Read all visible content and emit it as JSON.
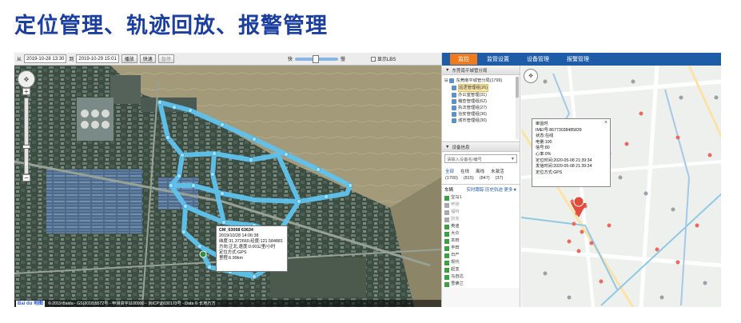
{
  "headline": "定位管理、轨迹回放、报警管理",
  "playback": {
    "toolbar": {
      "from_label": "从",
      "from_value": "2019-10-28 13:30",
      "to_label": "到",
      "to_value": "2019-10-29 15:01",
      "play_label": "播放",
      "fast_label": "快速",
      "pause_label": "暂停",
      "speed_fast": "快",
      "speed_slow": "慢",
      "show_lbs_label": "显示LBS"
    },
    "popup": {
      "title": "CM_63058 63634",
      "time": "2019/10/28 14:06:38",
      "coords": "纬度:31.372660,经度:121.584881",
      "direction": "方向:正北,速度:0.00公里/小时",
      "mode": "定位方式:GPS",
      "mileage": "里程:6.99km"
    },
    "footer": {
      "logo": "Bai du 地图",
      "copyright": "© 2019 Baidu - GS(2018)5572号 - 甲测资字1100930 - 京ICP证030173号 - Data © 长地万方"
    }
  },
  "monitor": {
    "nav_tabs": [
      "监控",
      "监管设置",
      "设备管理",
      "报警管理"
    ],
    "active_tab": "监控",
    "tree_header": "东莞南平城管分局",
    "tree": {
      "root": "东莞南平城管分局(1799)",
      "items": [
        {
          "label": "巡逻管理组(26)",
          "selected": true
        },
        {
          "label": "办公室管理(31)",
          "selected": false
        },
        {
          "label": "稽查管理组(62)",
          "selected": false
        },
        {
          "label": "执法管理组(27)",
          "selected": false
        },
        {
          "label": "治安管理组(36)",
          "selected": false
        },
        {
          "label": "城市管理组(30)",
          "selected": false
        }
      ]
    },
    "device_header": "设备信息",
    "search_placeholder": "请输入设备名/编号",
    "tabs": [
      "全部",
      "在线",
      "离线",
      "未激活"
    ],
    "counts": [
      "(1700)",
      "(815)",
      "(847)",
      "(37)"
    ],
    "list_head": {
      "left": "车辆",
      "right": "实时跟踪 历史轨迹 更多▼"
    },
    "vehicles": [
      {
        "label": "宝马1",
        "online": true
      },
      {
        "label": "奔驰",
        "online": false
      },
      {
        "label": "福特",
        "online": false
      },
      {
        "label": "别克",
        "online": false
      },
      {
        "label": "奥迪",
        "online": true
      },
      {
        "label": "大众",
        "online": true
      },
      {
        "label": "本田",
        "online": true
      },
      {
        "label": "丰田",
        "online": true
      },
      {
        "label": "日产",
        "online": true
      },
      {
        "label": "现代",
        "online": true
      },
      {
        "label": "起亚",
        "online": true
      },
      {
        "label": "马自达",
        "online": true
      },
      {
        "label": "雪佛兰",
        "online": true
      }
    ],
    "popup": {
      "title": "审监时",
      "imei": "IMEI号:86773038485839",
      "status": "状态:在线",
      "battery": "电量:100",
      "signal": "信号:80",
      "heart": "心率:0%",
      "locate_time": "定位时间:2020-05-08 21:39:34",
      "send_time": "发信时间:2020-05-08 21:39:34",
      "mode": "定位方式:GPS"
    }
  }
}
